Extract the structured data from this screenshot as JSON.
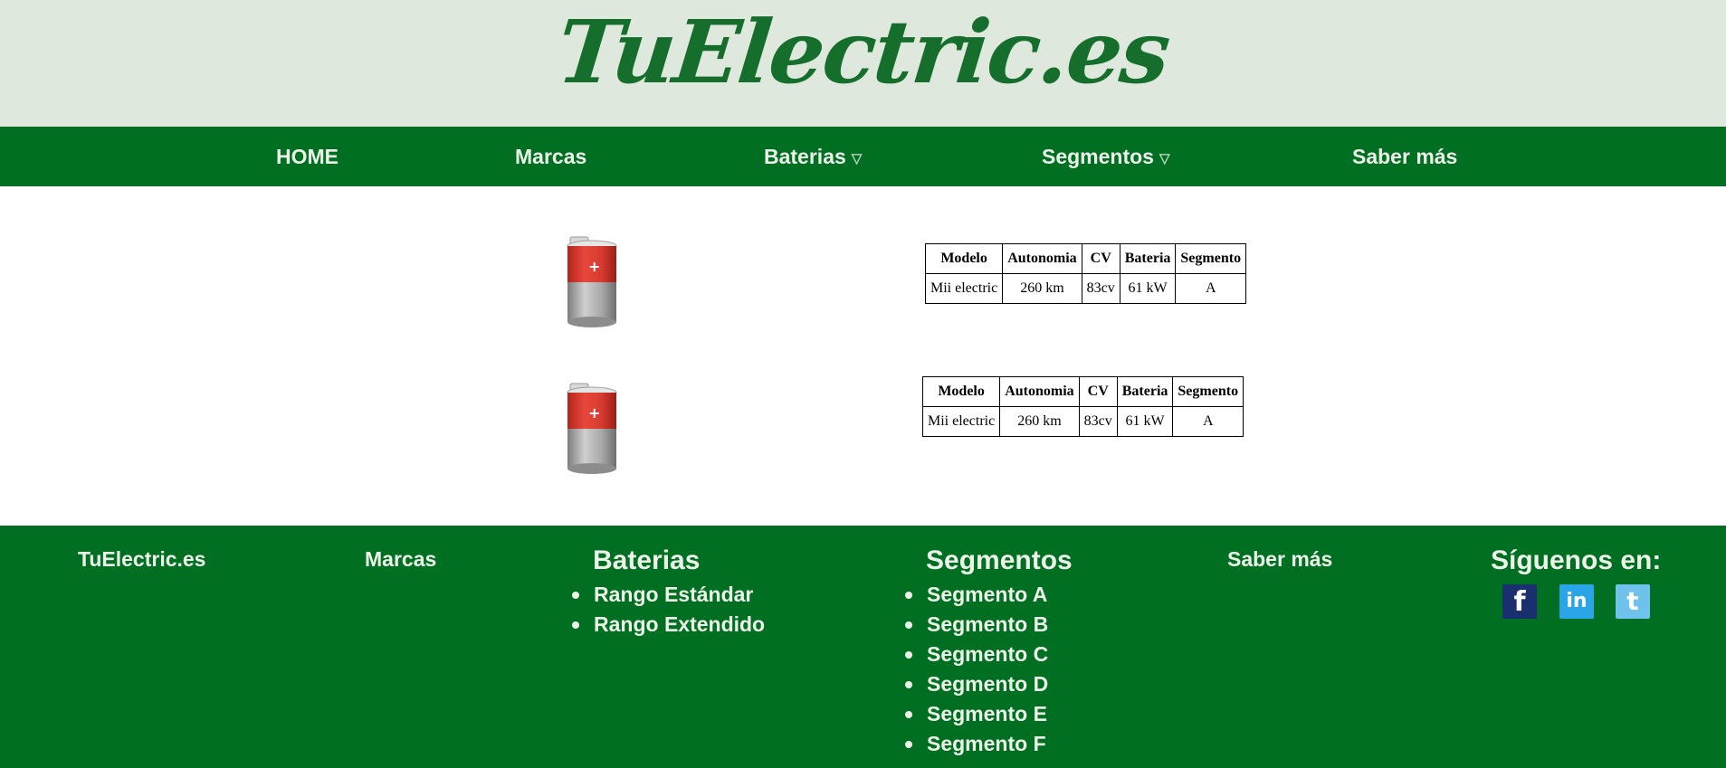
{
  "header": {
    "logo_text": "TuElectric.es"
  },
  "nav": {
    "items": [
      {
        "label": "HOME",
        "dropdown": false
      },
      {
        "label": "Marcas",
        "dropdown": false
      },
      {
        "label": "Baterias",
        "dropdown": true,
        "indicator": "▽"
      },
      {
        "label": "Segmentos",
        "dropdown": true,
        "indicator": "▽"
      },
      {
        "label": "Saber más",
        "dropdown": false
      }
    ]
  },
  "content": {
    "cards": [
      {
        "image_icon": "battery-icon",
        "table": {
          "headers": [
            "Modelo",
            "Autonomia",
            "CV",
            "Bateria",
            "Segmento"
          ],
          "row": [
            "Mii electric",
            "260 km",
            "83cv",
            "61 kW",
            "A"
          ]
        }
      },
      {
        "image_icon": "battery-icon",
        "table": {
          "headers": [
            "Modelo",
            "Autonomia",
            "CV",
            "Bateria",
            "Segmento"
          ],
          "row": [
            "Mii electric",
            "260 km",
            "83cv",
            "61 kW",
            "A"
          ]
        }
      }
    ]
  },
  "footer": {
    "brand": "TuElectric.es",
    "marcas": "Marcas",
    "baterias": {
      "title": "Baterias",
      "items": [
        "Rango Estándar",
        "Rango Extendido"
      ]
    },
    "segmentos": {
      "title": "Segmentos",
      "items": [
        "Segmento A",
        "Segmento B",
        "Segmento C",
        "Segmento D",
        "Segmento E",
        "Segmento F"
      ]
    },
    "saber_mas": "Saber más",
    "social": {
      "title": "Síguenos en:",
      "icons": [
        "facebook-icon",
        "linkedin-icon",
        "twitter-icon"
      ]
    }
  },
  "colors": {
    "header_bg": "#dfe8dd",
    "brand_green": "#006f22",
    "logo_green": "#166e2c",
    "light_text": "#eef3ea"
  }
}
